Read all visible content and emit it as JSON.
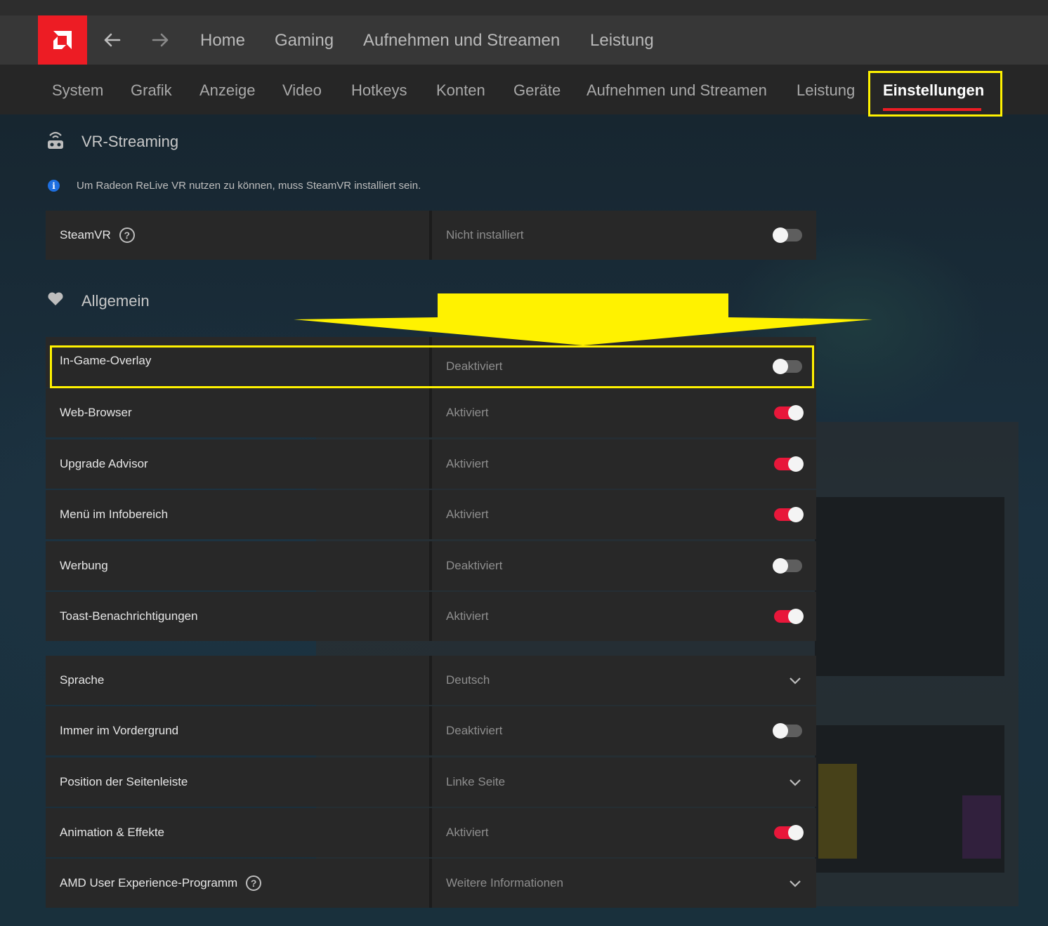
{
  "topnav": {
    "items": [
      {
        "label": "Home"
      },
      {
        "label": "Gaming"
      },
      {
        "label": "Aufnehmen und Streamen"
      },
      {
        "label": "Leistung"
      }
    ]
  },
  "subnav": {
    "items": [
      {
        "label": "System"
      },
      {
        "label": "Grafik"
      },
      {
        "label": "Anzeige"
      },
      {
        "label": "Video"
      },
      {
        "label": "Hotkeys"
      },
      {
        "label": "Konten"
      },
      {
        "label": "Geräte"
      },
      {
        "label": "Aufnehmen und Streamen"
      },
      {
        "label": "Leistung"
      },
      {
        "label": "Einstellungen"
      }
    ],
    "active": "Einstellungen"
  },
  "vr": {
    "title": "VR-Streaming",
    "info": "Um Radeon ReLive VR nutzen zu können, muss SteamVR installiert sein.",
    "rows": [
      {
        "label": "SteamVR",
        "value": "Nicht installiert",
        "toggle": false,
        "help": true
      }
    ]
  },
  "general": {
    "title": "Allgemein",
    "rows": [
      {
        "label": "In-Game-Overlay",
        "value": "Deaktiviert",
        "toggle": false
      },
      {
        "label": "Web-Browser",
        "value": "Aktiviert",
        "toggle": true
      },
      {
        "label": "Upgrade Advisor",
        "value": "Aktiviert",
        "toggle": true
      },
      {
        "label": "Menü im Infobereich",
        "value": "Aktiviert",
        "toggle": true
      },
      {
        "label": "Werbung",
        "value": "Deaktiviert",
        "toggle": false
      },
      {
        "label": "Toast-Benachrichtigungen",
        "value": "Aktiviert",
        "toggle": true
      }
    ]
  },
  "more": {
    "rows": [
      {
        "label": "Sprache",
        "value": "Deutsch",
        "control": "dropdown"
      },
      {
        "label": "Immer im Vordergrund",
        "value": "Deaktiviert",
        "control": "toggle",
        "toggle": false
      },
      {
        "label": "Position der Seitenleiste",
        "value": "Linke Seite",
        "control": "dropdown"
      },
      {
        "label": "Animation & Effekte",
        "value": "Aktiviert",
        "control": "toggle",
        "toggle": true
      },
      {
        "label": "AMD User Experience-Programm",
        "value": "Weitere Informationen",
        "control": "dropdown",
        "help": true
      }
    ]
  },
  "colors": {
    "brand": "#ed1c24",
    "toggle_on": "#e8173a",
    "annotation": "#fff200"
  },
  "icons": {
    "logo": "amd-logo-icon",
    "back": "arrow-left-icon",
    "forward": "arrow-right-icon",
    "vr": "vr-headset-icon",
    "general": "heart-icon",
    "info": "info-icon",
    "help": "question-circle-icon",
    "dropdown": "chevron-down-icon"
  }
}
